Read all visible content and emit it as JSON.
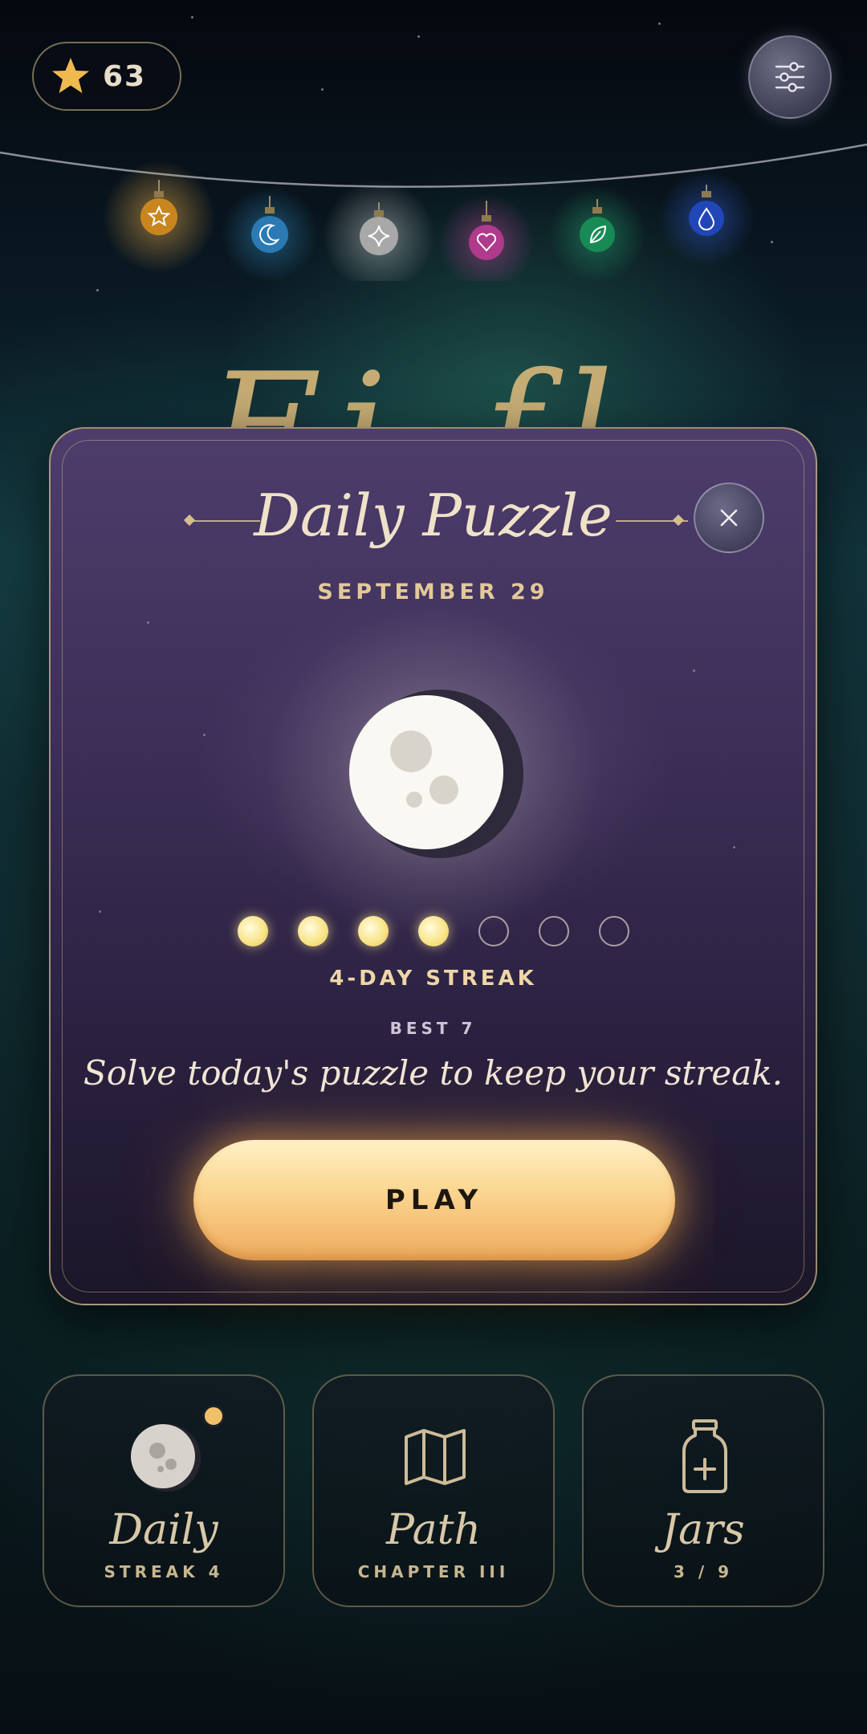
{
  "stars": {
    "count": "63",
    "icon": "star-icon"
  },
  "settings": {
    "icon": "sliders-icon"
  },
  "garland": {
    "bulbs": [
      {
        "icon": "star-icon",
        "color": "#e0a437"
      },
      {
        "icon": "moon-icon",
        "color": "#3c8ec4"
      },
      {
        "icon": "sparkle-icon",
        "color": "#bdbdbd"
      },
      {
        "icon": "heart-icon",
        "color": "#c24a9c"
      },
      {
        "icon": "leaf-icon",
        "color": "#27a067"
      },
      {
        "icon": "drop-icon",
        "color": "#2d5fd0"
      }
    ]
  },
  "background_title": "Fi  fl",
  "modal": {
    "title": "Daily Puzzle",
    "date": "SEPTEMBER 29",
    "streak_total_days": 7,
    "streak_filled_days": 4,
    "streak_label": "4-DAY STREAK",
    "best_label": "BEST 7",
    "subtitle": "Solve today's puzzle to keep your streak.",
    "play_label": "PLAY",
    "close_icon": "close-icon",
    "colors": {
      "accent": "#f2b66a",
      "gold": "#d6be8c"
    }
  },
  "cards": [
    {
      "name": "Daily",
      "sub": "STREAK 4",
      "icon": "moon-icon",
      "has_notification": true
    },
    {
      "name": "Path",
      "sub": "CHAPTER III",
      "icon": "map-icon"
    },
    {
      "name": "Jars",
      "sub": "3 / 9",
      "icon": "jar-icon"
    }
  ]
}
